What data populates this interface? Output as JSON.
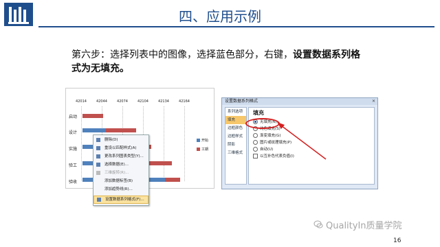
{
  "header": {
    "title": "四、应用示例",
    "logo_icon": "university-logo-icon",
    "brand_color": "#1f4e8c"
  },
  "step": {
    "prefix": "第六步：选择列表中的图像，选择蓝色部分，右键，",
    "bold": "设置数据系列格式为无填充。"
  },
  "chart": {
    "x_ticks": [
      "42014",
      "42044",
      "42074",
      "42104",
      "42134",
      "42164"
    ],
    "categories": [
      "启动",
      "设计",
      "实施",
      "验工",
      "验收"
    ],
    "legend": [
      "开始",
      "工期"
    ],
    "colors": {
      "start": "#4f81bd",
      "duration": "#c0504d"
    }
  },
  "context_menu": {
    "items": [
      "删除(D)",
      "重设以匹配样式(A)",
      "更改系列图表类型(Y)...",
      "选择数据(E)...",
      "三维旋转(R)...",
      "添加数据标签(B)",
      "添加趋势线(R)...",
      "设置数据系列格式(F)..."
    ]
  },
  "dialog": {
    "title": "设置数据系列格式",
    "nav": [
      "系列选项",
      "填充",
      "边框颜色",
      "边框样式",
      "阴影",
      "三维格式"
    ],
    "selected_nav": "填充",
    "section_title": "填充",
    "options": [
      "无填充(N)",
      "纯色填充(S)",
      "渐变填充(G)",
      "图片或纹理填充(P)",
      "自动(U)"
    ],
    "selected_option": "无填充(N)",
    "checkbox": "以互补色代表负值(I)"
  },
  "watermark": "QualityIn质量学院",
  "page_number": "16"
}
